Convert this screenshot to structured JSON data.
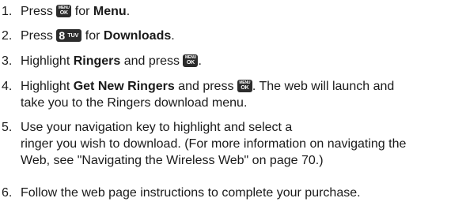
{
  "instructions": {
    "steps": [
      {
        "number": "1.",
        "parts": [
          "Press ",
          " for ",
          "Menu",
          "."
        ]
      },
      {
        "number": "2.",
        "parts": [
          "Press ",
          " for ",
          "Downloads",
          "."
        ]
      },
      {
        "number": "3.",
        "parts": [
          "Highlight ",
          "Ringers",
          " and press ",
          "."
        ]
      },
      {
        "number": "4.",
        "parts": [
          "Highlight ",
          "Get New Ringers",
          " and press ",
          ". The web will launch and",
          "take you to the Ringers download menu."
        ]
      },
      {
        "number": "5.",
        "lines": [
          "Use your navigation key to highlight and select a",
          "ringer you wish to download. (For more information on navigating the",
          "Web, see \"Navigating the Wireless Web\" on page 70.)"
        ]
      },
      {
        "number": "6.",
        "lines": [
          "Follow the web page instructions to complete your purchase."
        ]
      }
    ],
    "keys": {
      "menu_ok": {
        "top": "MENU",
        "bottom": "OK"
      },
      "eight_tuv": {
        "digit": "8",
        "letters": "TUV"
      }
    }
  }
}
